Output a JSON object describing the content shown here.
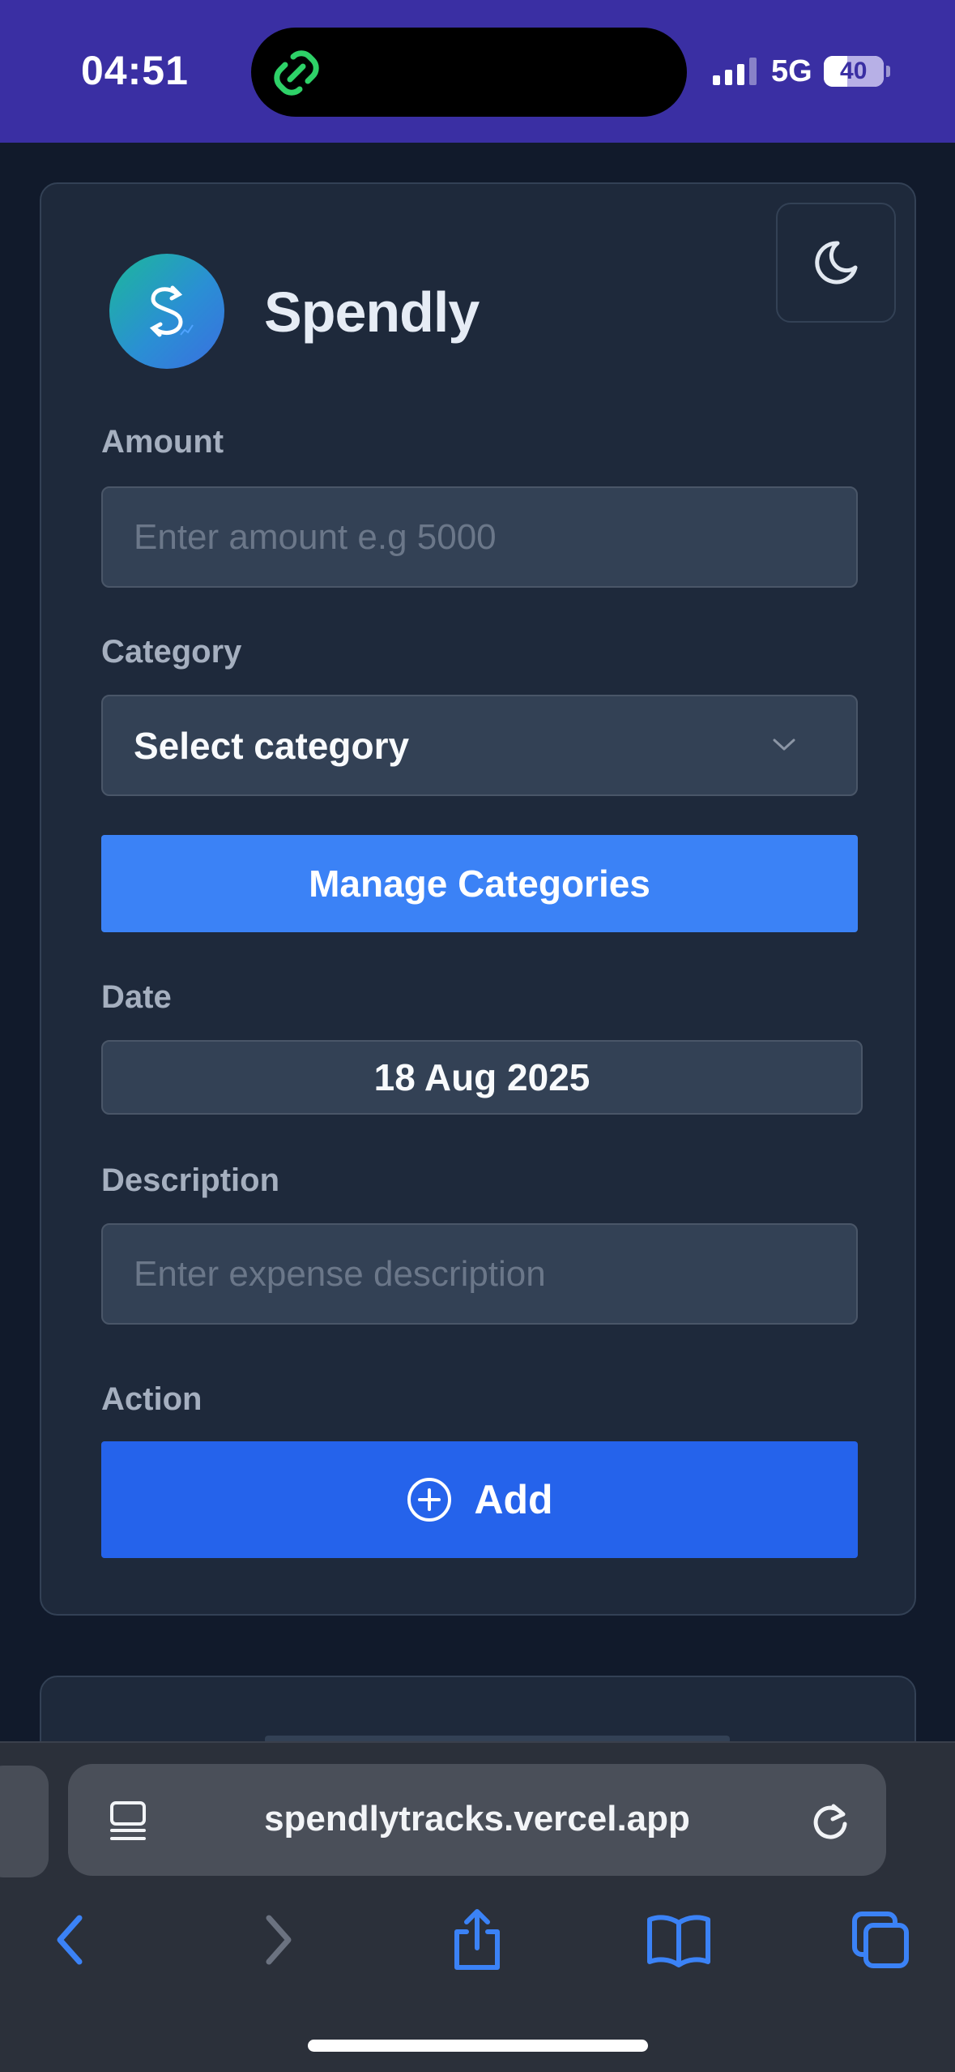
{
  "status_bar": {
    "time": "04:51",
    "network": "5G",
    "battery": "40",
    "battery_fraction": 0.4
  },
  "app": {
    "name": "Spendly"
  },
  "form": {
    "amount_label": "Amount",
    "amount_placeholder": "Enter amount e.g 5000",
    "category_label": "Category",
    "category_value": "Select category",
    "manage_button": "Manage Categories",
    "date_label": "Date",
    "date_value": "18 Aug 2025",
    "description_label": "Description",
    "description_placeholder": "Enter expense description",
    "action_label": "Action",
    "add_button": "Add"
  },
  "browser": {
    "url": "spendlytracks.vercel.app"
  },
  "colors": {
    "status_bar_bg": "#3a2fa3",
    "page_bg": "#111a2b",
    "card_bg": "#1e293b",
    "manage_button": "#3b82f6",
    "add_button": "#2563eb",
    "browser_accent": "#3b82f6"
  },
  "icons": {
    "island": "link-icon",
    "theme_toggle": "moon-icon",
    "logo": "dollar-icon",
    "select": "chevron-down-icon",
    "add": "plus-circle-icon",
    "reader": "reader-mode-icon",
    "reload": "reload-icon",
    "back": "back-icon",
    "forward": "forward-icon",
    "share": "share-icon",
    "bookmarks": "bookmarks-icon",
    "tabs": "tabs-icon"
  }
}
